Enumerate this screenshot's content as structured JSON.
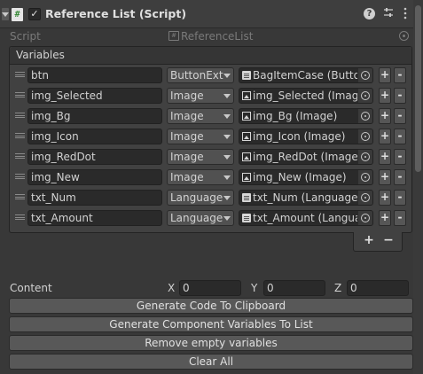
{
  "component": {
    "title": "Reference List (Script)",
    "enabled_mark": "✓",
    "script_icon_glyph": "#",
    "header_icons": [
      "help-icon",
      "presets-icon",
      "more-icon"
    ]
  },
  "script_row": {
    "label": "Script",
    "value": "ReferenceList"
  },
  "variables": {
    "header": "Variables",
    "items": [
      {
        "name": "btn",
        "type": "ButtonExt",
        "ref": "BagItemCase (Button",
        "icon": "doc"
      },
      {
        "name": "img_Selected",
        "type": "Image",
        "ref": "img_Selected (Image",
        "icon": "img"
      },
      {
        "name": "img_Bg",
        "type": "Image",
        "ref": "img_Bg (Image)",
        "icon": "img"
      },
      {
        "name": "img_Icon",
        "type": "Image",
        "ref": "img_Icon (Image)",
        "icon": "img"
      },
      {
        "name": "img_RedDot",
        "type": "Image",
        "ref": "img_RedDot (Image)",
        "icon": "img"
      },
      {
        "name": "img_New",
        "type": "Image",
        "ref": "img_New (Image)",
        "icon": "img"
      },
      {
        "name": "txt_Num",
        "type": "Language",
        "ref": "txt_Num (Language T",
        "icon": "doc"
      },
      {
        "name": "txt_Amount",
        "type": "Language",
        "ref": "txt_Amount (Languag",
        "icon": "doc"
      }
    ],
    "plus_label": "+",
    "minus_label": "-",
    "footer_add_label": "+",
    "footer_remove_label": "−"
  },
  "content": {
    "label": "Content",
    "x_label": "X",
    "x_value": "0",
    "y_label": "Y",
    "y_value": "0",
    "z_label": "Z",
    "z_value": "0"
  },
  "buttons": {
    "copy_code": "Generate Code To Clipboard",
    "generate_vars": "Generate Component Variables To List",
    "remove_empty": "Remove empty variables",
    "clear_all": "Clear All"
  }
}
